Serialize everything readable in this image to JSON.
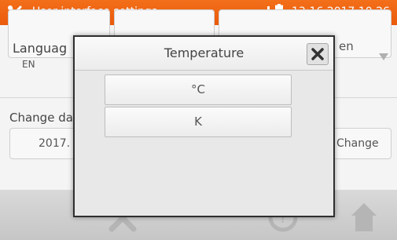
{
  "statusbar": {
    "title": "User interface settings",
    "clock": "13:16 2017.10.26",
    "icons": {
      "left": "tools-icon",
      "signal": "signal-icon",
      "battery": "battery-icon"
    },
    "bg_color": "#f07020"
  },
  "background": {
    "language_label": "Languag",
    "language_value": "EN",
    "right_card_fragment": "en",
    "change_date_label": "Change da",
    "date_fragment": "2017.",
    "change_button": "Change"
  },
  "bottombar": {
    "icons": [
      "tools-icon",
      "help-icon",
      "home-icon"
    ]
  },
  "dialog": {
    "title": "Temperature",
    "close_icon": "close-icon",
    "options": [
      "°C",
      "K"
    ]
  }
}
